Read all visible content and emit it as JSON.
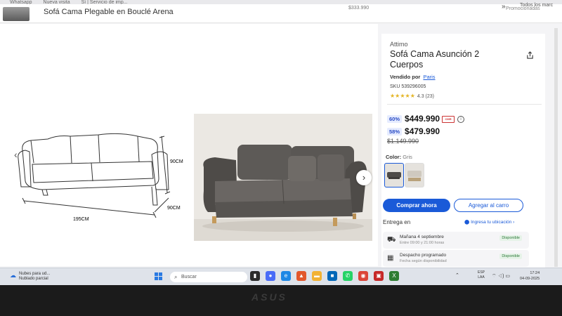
{
  "browser": {
    "bookmarks": [
      "Whatsapp",
      "Nueva visita",
      "Sí | Servicio de imp...",
      "Todos los marcadores"
    ]
  },
  "sticky": {
    "product_title": "Sofá Cama Plegable en Bouclé Arena",
    "price_ghost": "$333.990",
    "promo": "Promocionadas",
    "more": "»",
    "extra": "Todos los marc"
  },
  "gallery": {
    "prev": "‹",
    "next": "›",
    "dimensions": {
      "height": "90CM",
      "depth": "90CM",
      "width": "195CM"
    }
  },
  "product": {
    "brand": "Attimo",
    "title": "Sofá Cama Asunción 2 Cuerpos",
    "sold_by_label": "Vendido por",
    "seller": "Paris",
    "sku": "SKU 539296005",
    "rating_stars": "★★★★★",
    "rating_text": "4.3 (23)",
    "rating_value": 4.3,
    "prices": [
      {
        "badge": "60%",
        "amount": "$449.990",
        "type": "cmr"
      },
      {
        "badge": "58%",
        "amount": "$479.990",
        "type": "internet"
      }
    ],
    "original_price": "$1.149.990",
    "color_label": "Color:",
    "color_value": "Gris",
    "buy_button": "Comprar ahora",
    "cart_button": "Agregar al carro",
    "delivery_label": "Entrega en",
    "location_link": "Ingresa tu ubicación",
    "delivery_options": [
      {
        "title": "Mañana 4 septiembre",
        "sub": "Entre 09:00 y 21:00 horas",
        "status": "Disponible"
      },
      {
        "title": "Despacho programado",
        "sub": "Fecha según disponibilidad",
        "status": "Disponible"
      }
    ]
  },
  "taskbar": {
    "weather_line1": "Nubes para ud...",
    "weather_line2": "Nublado parcial",
    "search_placeholder": "Buscar",
    "lang_line1": "ESP",
    "lang_line2": "LAA",
    "time": "17:24",
    "date": "04-09-2025"
  },
  "bezel_logo": "ASUS",
  "colors": {
    "accent": "#1a5ad8",
    "star": "#e4b526",
    "available": "#2d7a3a",
    "sofa": "#5a5754"
  }
}
